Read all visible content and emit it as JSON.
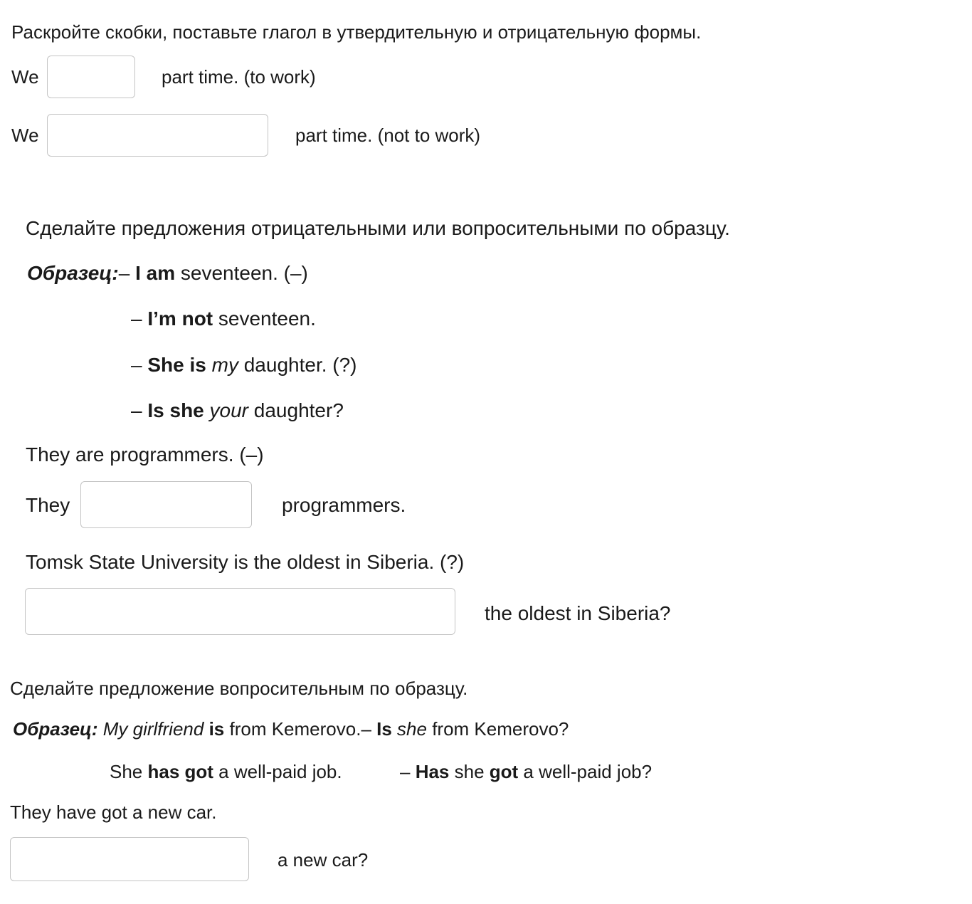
{
  "section1": {
    "instruction": "Раскройте скобки, поставьте глагол в утвердительную и отрицательную формы.",
    "q1": {
      "prefix": "We",
      "value": "",
      "suffix": "part time. (to work)"
    },
    "q2": {
      "prefix": "We",
      "value": "",
      "suffix": "part time. (not to work)"
    }
  },
  "section2": {
    "instruction": "Сделайте предложения отрицательными или вопросительными по образцу.",
    "sample_label": "Образец:",
    "sample_line1": {
      "dash": "– ",
      "bold": "I am",
      "rest": " seventeen. (–)"
    },
    "sample_line2": {
      "dash": "– ",
      "bold": "I’m not",
      "rest": " seventeen."
    },
    "sample_line3": {
      "dash": "– ",
      "bold": "She is",
      "italic": "my",
      "rest": " daughter. (?)"
    },
    "sample_line4": {
      "dash": "– ",
      "bold": "Is she",
      "italic": "your",
      "rest": " daughter?"
    },
    "task1_sentence": "They are programmers. (–)",
    "task1_answer": {
      "prefix": "They",
      "value": "",
      "suffix": "programmers."
    },
    "task2_sentence": "Tomsk State University is the oldest in Siberia. (?)",
    "task2_answer": {
      "value": "",
      "suffix": "the oldest in Siberia?"
    }
  },
  "section3": {
    "instruction": "Сделайте предложение вопросительным по образцу.",
    "sample_label": "Образец:",
    "sample_a": {
      "italic1": "My girlfriend",
      "bold1": "is",
      "rest1": " from Kemerovo.",
      "dash": "– ",
      "bold2": "Is",
      "italic2": "she",
      "rest2": " from Kemerovo?"
    },
    "sample_b": {
      "pre": "She ",
      "bold1": "has got",
      "rest1": " a well-paid job.",
      "dash": "– ",
      "bold2": "Has",
      "mid": " she ",
      "bold3": "got",
      "rest2": " a well-paid job?"
    },
    "task_sentence": "They have got a new car.",
    "task_answer": {
      "value": "",
      "suffix": "a new car?"
    }
  }
}
